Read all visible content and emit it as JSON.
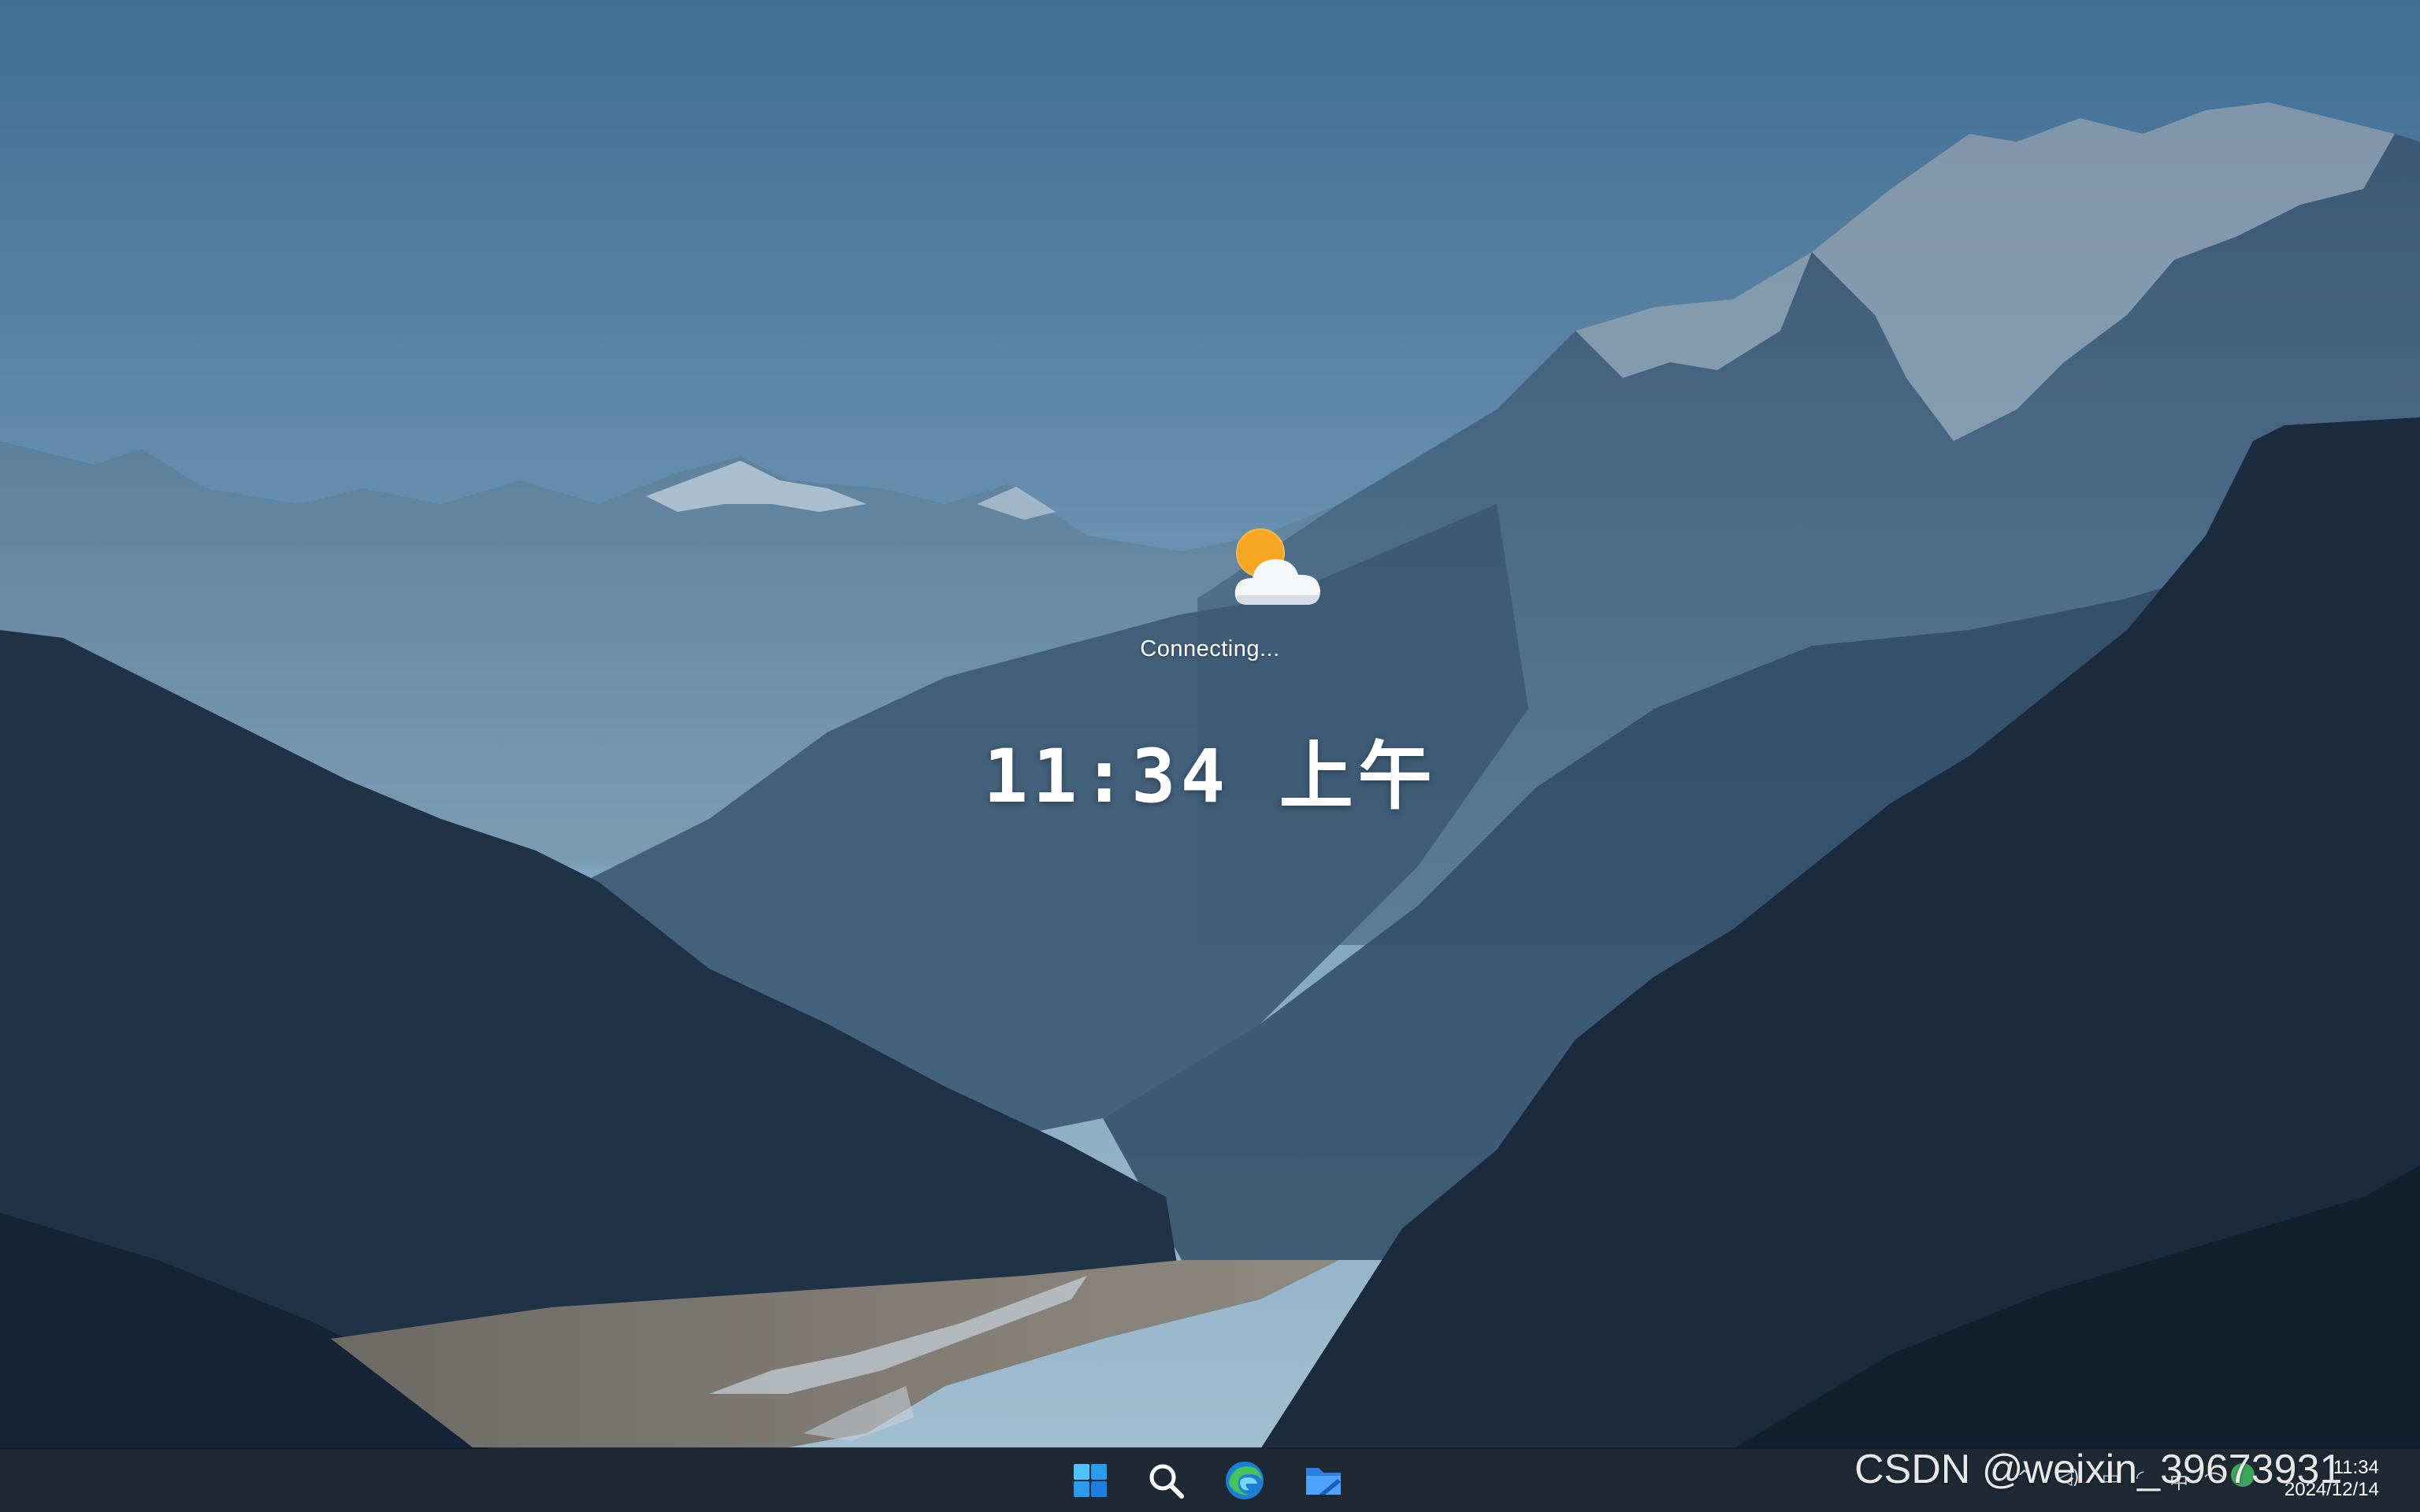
{
  "weather": {
    "icon": "partly-cloudy-icon",
    "status": "Connecting..."
  },
  "clock": {
    "time": "11:34 上午"
  },
  "taskbar": {
    "apps": [
      {
        "name": "Start",
        "icon": "windows-start-icon"
      },
      {
        "name": "Search",
        "icon": "search-icon"
      },
      {
        "name": "Microsoft Edge",
        "icon": "edge-icon"
      },
      {
        "name": "Files",
        "icon": "files-icon"
      }
    ],
    "tray": {
      "chevron": "^",
      "ime": "中",
      "time": "11:34",
      "date": "2024/12/14"
    }
  },
  "watermark": "CSDN @weixin_39673931",
  "colors": {
    "sky_top": "#3f6d93",
    "sky_bottom": "#8eb1c7",
    "mountain_far": "#4c6c86",
    "mountain_mid": "#2f4b63",
    "forest": "#17283a",
    "taskbar": "#141c26",
    "sun": "#f5a623",
    "edge_blue": "#1b7fd6",
    "edge_green": "#46c25e"
  }
}
